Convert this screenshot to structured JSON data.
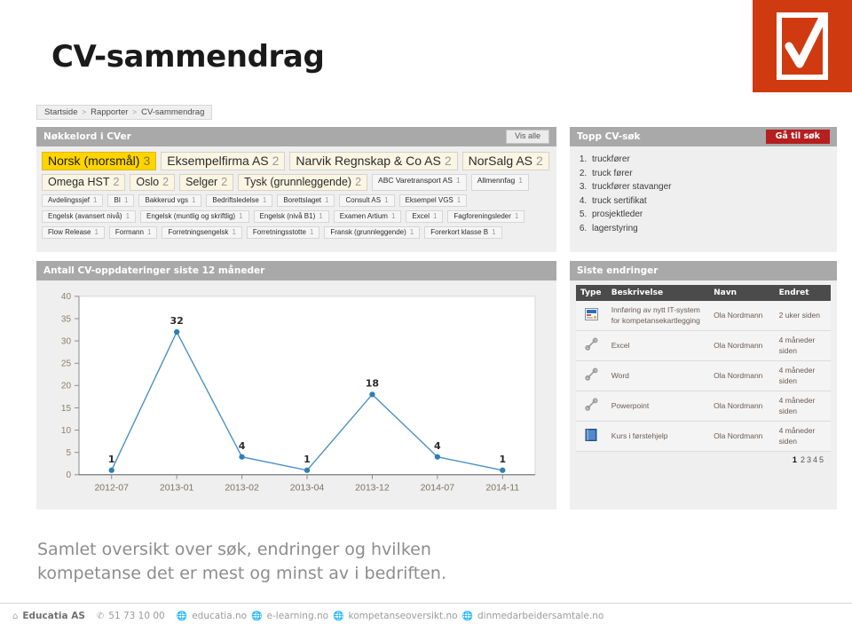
{
  "slide": {
    "title": "CV-sammendrag",
    "caption": "Samlet oversikt over søk, endringer og hvilken kompetanse det er mest og minst av i bedriften.",
    "logo_icon": "checkbox-check-icon",
    "logo_color": "#d03a10"
  },
  "breadcrumb": {
    "items": [
      "Startside",
      "Rapporter",
      "CV-sammendrag"
    ],
    "separator": ">"
  },
  "keywords_panel": {
    "title": "Nøkkelord i CVer",
    "show_all_label": "Vis alle",
    "tags": [
      {
        "label": "Norsk (morsmål)",
        "count": "3",
        "size": "s0",
        "highlight": true
      },
      {
        "label": "Eksempelfirma AS",
        "count": "2",
        "size": "s0",
        "highlight": false
      },
      {
        "label": "Narvik Regnskap & Co AS",
        "count": "2",
        "size": "s0",
        "highlight": false
      },
      {
        "label": "NorSalg AS",
        "count": "2",
        "size": "s0",
        "highlight": false
      },
      {
        "label": "Omega HST",
        "count": "2",
        "size": "s1",
        "highlight": false
      },
      {
        "label": "Oslo",
        "count": "2",
        "size": "s1",
        "highlight": false
      },
      {
        "label": "Selger",
        "count": "2",
        "size": "s1",
        "highlight": false
      },
      {
        "label": "Tysk (grunnleggende)",
        "count": "2",
        "size": "s1",
        "highlight": false
      },
      {
        "label": "ABC Varetransport AS",
        "count": "1",
        "size": "s2",
        "highlight": false,
        "plain": true
      },
      {
        "label": "Allmennfag",
        "count": "1",
        "size": "s2",
        "highlight": false,
        "plain": true
      },
      {
        "label": "Avdelingssjef",
        "count": "1",
        "size": "s3",
        "highlight": false,
        "plain": true
      },
      {
        "label": "BI",
        "count": "1",
        "size": "s3",
        "highlight": false,
        "plain": true
      },
      {
        "label": "Bakkerud vgs",
        "count": "1",
        "size": "s3",
        "highlight": false,
        "plain": true
      },
      {
        "label": "Bedriftsledelse",
        "count": "1",
        "size": "s3",
        "highlight": false,
        "plain": true
      },
      {
        "label": "Borettslaget",
        "count": "1",
        "size": "s3",
        "highlight": false,
        "plain": true
      },
      {
        "label": "Consult AS",
        "count": "1",
        "size": "s3",
        "highlight": false,
        "plain": true
      },
      {
        "label": "Eksempel VGS",
        "count": "1",
        "size": "s3",
        "highlight": false,
        "plain": true
      },
      {
        "label": "Engelsk (avansert nivå)",
        "count": "1",
        "size": "s3",
        "highlight": false,
        "plain": true
      },
      {
        "label": "Engelsk (muntlig og skriftlig)",
        "count": "1",
        "size": "s3",
        "highlight": false,
        "plain": true
      },
      {
        "label": "Engelsk (nivå B1)",
        "count": "1",
        "size": "s3",
        "highlight": false,
        "plain": true
      },
      {
        "label": "Examen Artium",
        "count": "1",
        "size": "s3",
        "highlight": false,
        "plain": true
      },
      {
        "label": "Excel",
        "count": "1",
        "size": "s3",
        "highlight": false,
        "plain": true
      },
      {
        "label": "Fagforeningsleder",
        "count": "1",
        "size": "s3",
        "highlight": false,
        "plain": true
      },
      {
        "label": "Flow Release",
        "count": "1",
        "size": "s3",
        "highlight": false,
        "plain": true
      },
      {
        "label": "Formann",
        "count": "1",
        "size": "s3",
        "highlight": false,
        "plain": true
      },
      {
        "label": "Forretningsengelsk",
        "count": "1",
        "size": "s3",
        "highlight": false,
        "plain": true
      },
      {
        "label": "Forretningsstotte",
        "count": "1",
        "size": "s3",
        "highlight": false,
        "plain": true
      },
      {
        "label": "Fransk (grunnleggende)",
        "count": "1",
        "size": "s3",
        "highlight": false,
        "plain": true
      },
      {
        "label": "Forerkort klasse B",
        "count": "1",
        "size": "s3",
        "highlight": false,
        "plain": true
      }
    ]
  },
  "top_search_panel": {
    "title": "Topp CV-søk",
    "button_label": "Gå til søk",
    "items": [
      "truckfører",
      "truck fører",
      "truckfører stavanger",
      "truck sertifikat",
      "prosjektleder",
      "lagerstyring"
    ]
  },
  "chart_panel": {
    "title": "Antall CV-oppdateringer siste 12 måneder"
  },
  "chart_data": {
    "type": "line",
    "title": "Antall CV-oppdateringer siste 12 måneder",
    "xlabel": "",
    "ylabel": "",
    "categories": [
      "2012-07",
      "2013-01",
      "2013-02",
      "2013-04",
      "2013-12",
      "2014-07",
      "2014-11"
    ],
    "values": [
      1,
      32,
      4,
      1,
      18,
      4,
      1
    ],
    "point_labels": [
      "1",
      "32",
      "4",
      "1",
      "18",
      "4",
      "1"
    ],
    "ylim": [
      0,
      40
    ],
    "yticks": [
      "0",
      "5",
      "10",
      "15",
      "20",
      "25",
      "30",
      "35",
      "40"
    ],
    "grid": false,
    "legend": "none",
    "series_color": "#4a90c4",
    "marker_color": "#2f7fb5"
  },
  "changes_panel": {
    "title": "Siste endringer",
    "columns": [
      "Type",
      "Beskrivelse",
      "Navn",
      "Endret"
    ],
    "rows": [
      {
        "icon": "presentation-icon",
        "beskrivelse": "Innføring av nytt IT-system for kompetansekartlegging",
        "navn": "Ola Nordmann",
        "endret": "2 uker siden"
      },
      {
        "icon": "wrench-icon",
        "beskrivelse": "Excel",
        "navn": "Ola Nordmann",
        "endret": "4 måneder siden"
      },
      {
        "icon": "wrench-icon",
        "beskrivelse": "Word",
        "navn": "Ola Nordmann",
        "endret": "4 måneder siden"
      },
      {
        "icon": "wrench-icon",
        "beskrivelse": "Powerpoint",
        "navn": "Ola Nordmann",
        "endret": "4 måneder siden"
      },
      {
        "icon": "book-icon",
        "beskrivelse": "Kurs i førstehjelp",
        "navn": "Ola Nordmann",
        "endret": "4 måneder siden"
      }
    ],
    "pagination": {
      "current": "1",
      "pages": [
        "2",
        "3",
        "4",
        "5"
      ]
    }
  },
  "footer": {
    "company": "Educatia AS",
    "phone": "51 73 10 00",
    "links": [
      "educatia.no",
      "e-learning.no",
      "kompetanseoversikt.no",
      "dinmedarbeidersamtale.no"
    ],
    "phone_icon": "phone-icon",
    "home_icon": "home-icon",
    "globe_icon": "globe-icon"
  }
}
